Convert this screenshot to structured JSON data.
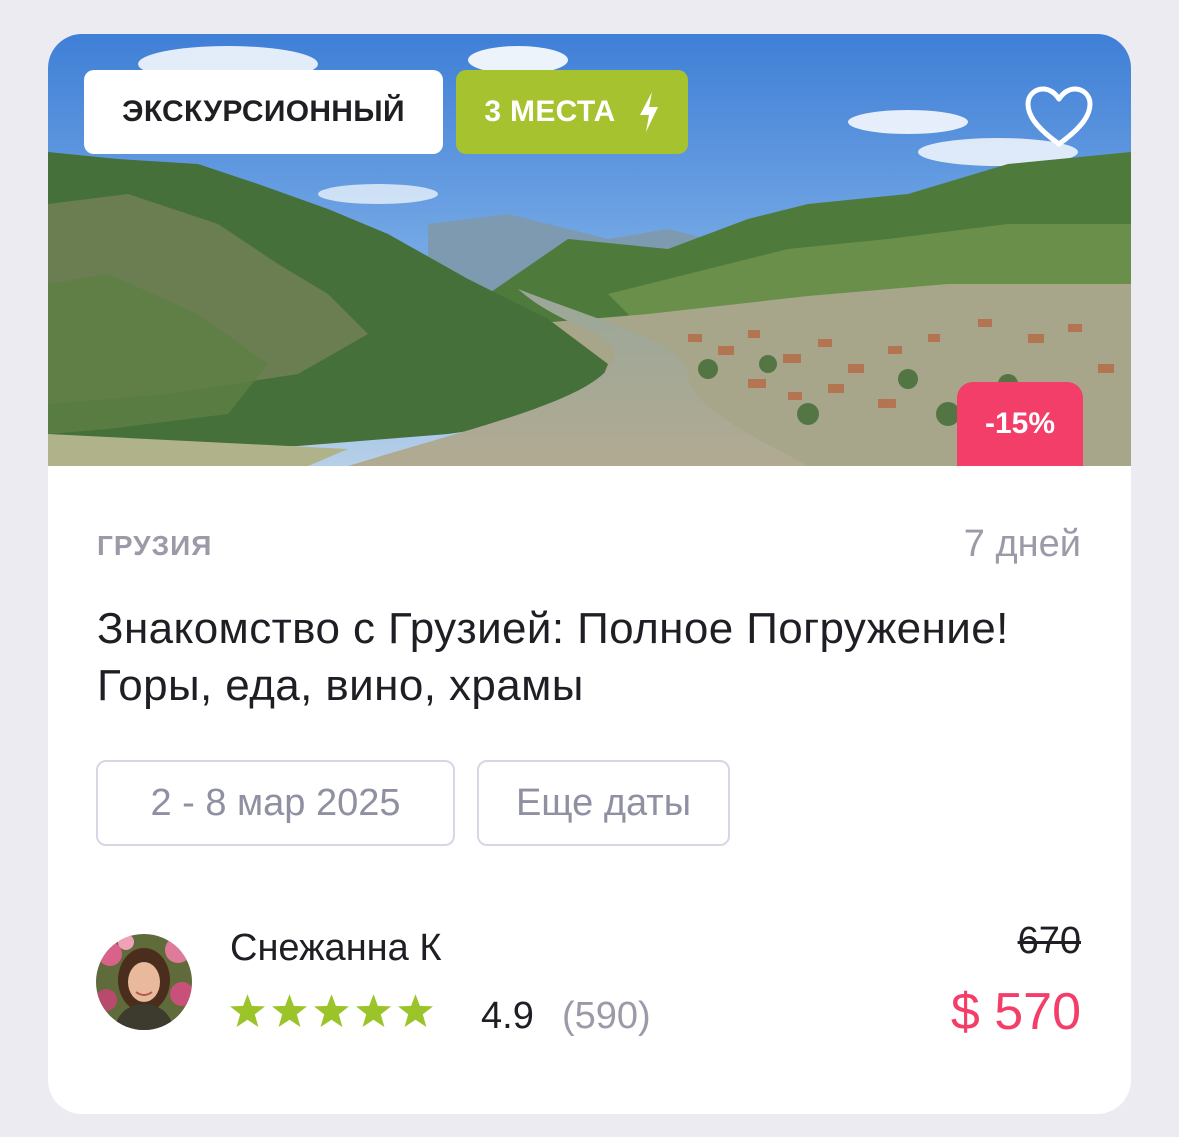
{
  "tour": {
    "type_label": "ЭКСКУРСИОННЫЙ",
    "seats_label": "3 МЕСТА",
    "discount": "-15%",
    "country": "ГРУЗИЯ",
    "duration": "7 дней",
    "title": "Знакомство с Грузией: Полное Погружение! Горы, еда, вино, храмы",
    "dates_chip": "2 - 8 мар 2025",
    "more_dates_chip": "Еще даты",
    "image_description_icon": "landscape-photo"
  },
  "guide": {
    "name": "Снежанна К",
    "rating": "4.9",
    "reviews": "(590)",
    "stars": 5
  },
  "price": {
    "old": "670",
    "current": "$ 570"
  },
  "colors": {
    "accent_green": "#a6c22f",
    "accent_pink": "#f23e68",
    "muted_text": "#9b9aa8",
    "star_green": "#9bc42a"
  },
  "icons": {
    "favorite": "heart-icon",
    "seats": "lightning-icon",
    "rating": "star-icon"
  }
}
